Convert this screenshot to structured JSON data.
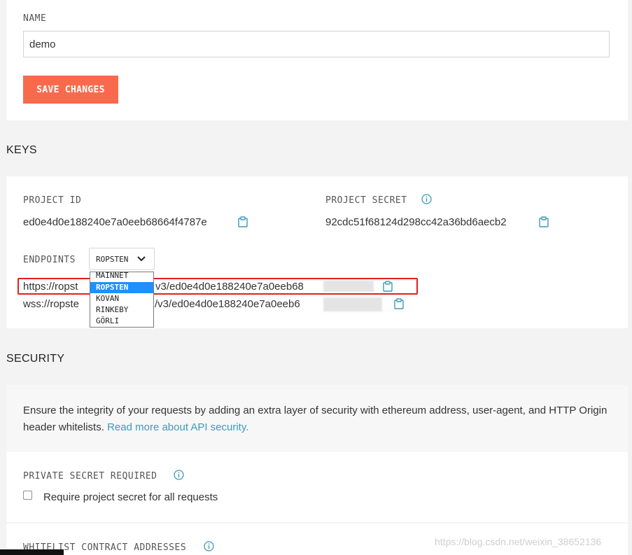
{
  "general": {
    "name_label": "NAME",
    "name_value": "demo",
    "save_label": "SAVE CHANGES"
  },
  "keys": {
    "title": "KEYS",
    "project_id_label": "PROJECT ID",
    "project_id_value": "ed0e4d0e188240e7a0eeb68664f4787e",
    "project_secret_label": "PROJECT SECRET",
    "project_secret_value": "92cdc51f68124d298cc42a36bd6aecb2",
    "endpoints_label": "ENDPOINTS",
    "network_selected": "ROPSTEN",
    "network_options": [
      "MAINNET",
      "ROPSTEN",
      "KOVAN",
      "RINKEBY",
      "GÖRLI"
    ],
    "https_prefix": "https://ropst",
    "https_suffix": "v3/ed0e4d0e188240e7a0eeb68",
    "wss_prefix": "wss://ropste",
    "wss_suffix": "/v3/ed0e4d0e188240e7a0eeb6"
  },
  "security": {
    "title": "SECURITY",
    "intro_text": "Ensure the integrity of your requests by adding an extra layer of security with ethereum address, user-agent, and HTTP Origin header whitelists.",
    "intro_link": "Read more about API security.",
    "private_secret_label": "PRIVATE SECRET REQUIRED",
    "require_secret_label": "Require project secret for all requests",
    "whitelist_label": "WHITELIST CONTRACT ADDRESSES"
  },
  "watermark": "https://blog.csdn.net/weixin_38652136",
  "colors": {
    "accent": "#f96a4d",
    "icon": "#3a9bb8",
    "highlight": "#e02020",
    "selected_option": "#1e90ff"
  },
  "icons": [
    "clipboard-icon",
    "info-icon",
    "chevron-down-icon"
  ]
}
